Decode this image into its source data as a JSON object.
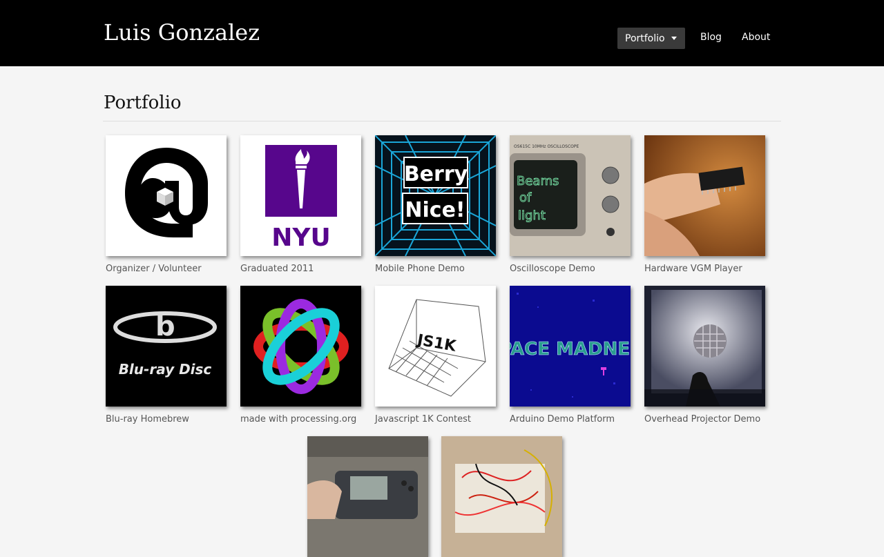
{
  "header": {
    "site_title": "Luis Gonzalez",
    "nav": {
      "portfolio": "Portfolio",
      "blog": "Blog",
      "about": "About"
    }
  },
  "main": {
    "title": "Portfolio",
    "items": [
      {
        "caption": "Organizer / Volunteer",
        "image_text": ""
      },
      {
        "caption": "Graduated 2011",
        "image_text": "NYU"
      },
      {
        "caption": "Mobile Phone Demo",
        "image_text_1": "Berry",
        "image_text_2": "Nice!"
      },
      {
        "caption": "Oscilloscope Demo",
        "image_text_1": "Beams",
        "image_text_2": "of",
        "image_text_3": "light",
        "scope_label": "OS615C 10MHz OSCILLOSCOPE"
      },
      {
        "caption": "Hardware VGM Player"
      },
      {
        "caption": "Blu-ray Homebrew",
        "image_text": "Blu-ray Disc"
      },
      {
        "caption": "made with processing.org"
      },
      {
        "caption": "Javascript 1K Contest",
        "image_text": "JS1K"
      },
      {
        "caption": "Arduino Demo Platform",
        "image_text": "SPACE MADNESS"
      },
      {
        "caption": "Overhead Projector Demo"
      }
    ]
  }
}
